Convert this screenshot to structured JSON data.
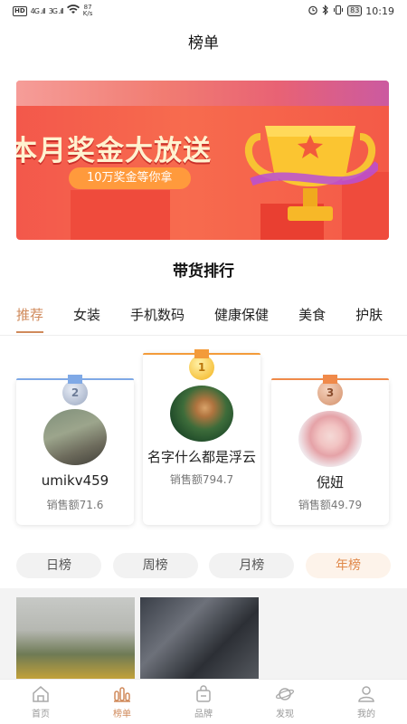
{
  "status_bar": {
    "network": "HD",
    "signal1": "4G .ıll",
    "signal2": "3G .ıll",
    "speed_value": "87",
    "speed_unit": "K/s",
    "battery": "83",
    "time": "10:19"
  },
  "header": {
    "title": "榜单"
  },
  "banner": {
    "title": "本月奖金大放送",
    "subtitle": "10万奖金等你拿"
  },
  "section": {
    "title": "带货排行"
  },
  "category_tabs": [
    {
      "label": "推荐",
      "active": true
    },
    {
      "label": "女装"
    },
    {
      "label": "手机数码"
    },
    {
      "label": "健康保健"
    },
    {
      "label": "美食"
    },
    {
      "label": "护肤"
    }
  ],
  "ranking": [
    {
      "rank": "2",
      "name": "umikv459",
      "sales": "销售额71.6"
    },
    {
      "rank": "1",
      "name": "名字什么都是浮云",
      "sales": "销售额794.7"
    },
    {
      "rank": "3",
      "name": "倪妞",
      "sales": "销售额49.79"
    }
  ],
  "period_tabs": [
    {
      "label": "日榜"
    },
    {
      "label": "周榜"
    },
    {
      "label": "月榜"
    },
    {
      "label": "年榜",
      "active": true
    }
  ],
  "bottom_nav": [
    {
      "label": "首页",
      "icon": "home-icon"
    },
    {
      "label": "榜单",
      "icon": "ranking-icon",
      "active": true
    },
    {
      "label": "品牌",
      "icon": "bag-icon"
    },
    {
      "label": "发现",
      "icon": "planet-icon"
    },
    {
      "label": "我的",
      "icon": "user-icon"
    }
  ],
  "colors": {
    "accent": "#d08a5b",
    "banner_red": "#f3584b",
    "period_active": "#e0894b"
  }
}
